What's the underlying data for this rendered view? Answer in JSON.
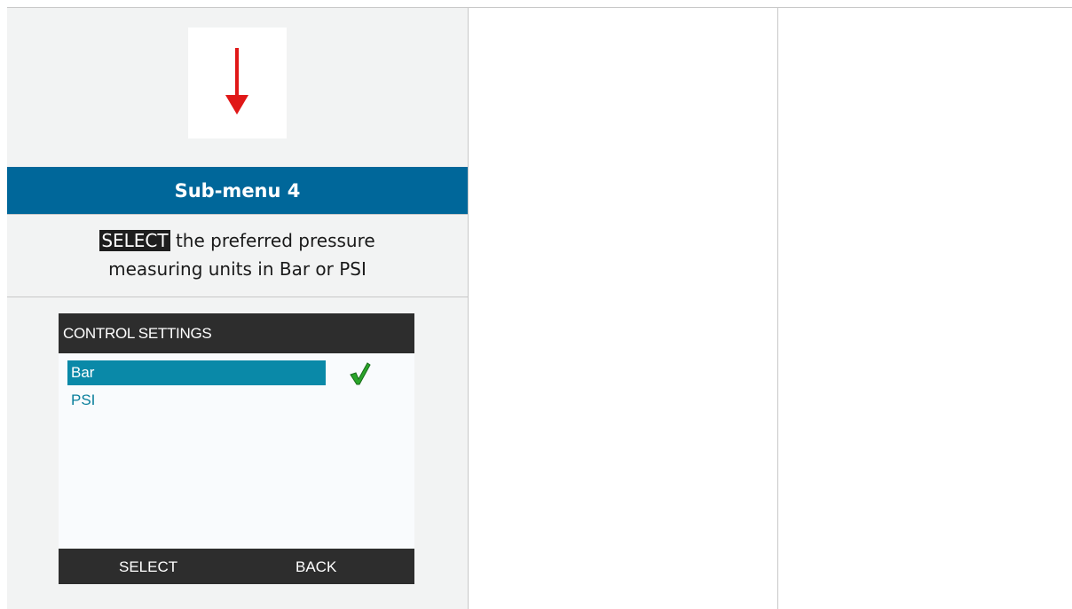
{
  "section": {
    "title": "Sub-menu 4",
    "instruction_key": "SELECT",
    "instruction_line1_rest": " the preferred pressure",
    "instruction_line2": "measuring units in Bar or PSI"
  },
  "screen": {
    "header": "CONTROL SETTINGS",
    "options": [
      {
        "label": "Bar",
        "selected": true
      },
      {
        "label": "PSI",
        "selected": false
      }
    ],
    "softkeys": {
      "left": "SELECT",
      "right": "BACK"
    }
  },
  "colors": {
    "header_blue": "#00679a",
    "arrow_red": "#e01818",
    "highlight": "#0a89a8",
    "check_green": "#2aa52a"
  },
  "icons": {
    "arrow": "arrow-down-icon",
    "check": "checkmark-icon"
  }
}
